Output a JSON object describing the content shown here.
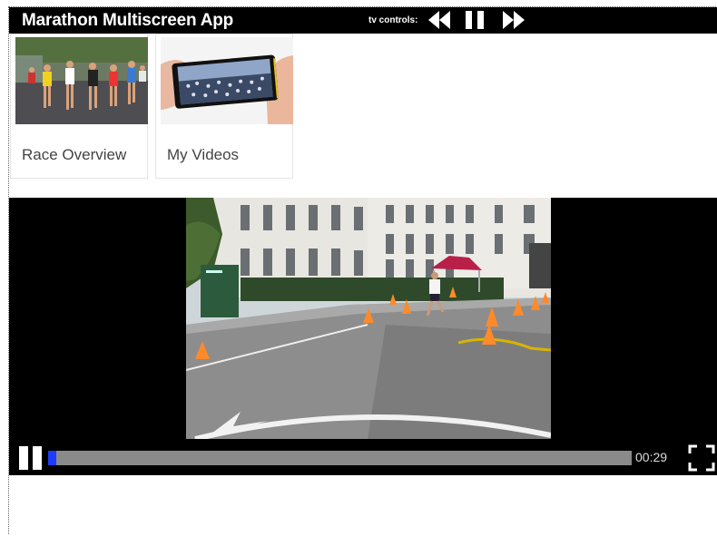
{
  "header": {
    "title": "Marathon Multiscreen App",
    "tv_controls_label": "tv controls:",
    "icons": [
      "rewind-icon",
      "pause-icon",
      "fast-forward-icon"
    ]
  },
  "cards": [
    {
      "label": "Race Overview",
      "thumbnail": "marathon-runners-photo"
    },
    {
      "label": "My Videos",
      "thumbnail": "phone-recording-photo"
    }
  ],
  "player": {
    "time": "00:29",
    "progress": 0.014,
    "icons": [
      "pause-icon",
      "fullscreen-icon"
    ]
  },
  "colors": {
    "header_bg": "#000000",
    "player_bg": "#000000",
    "progress_track": "#8a8a8a",
    "progress_fill": "#1c3cff"
  }
}
